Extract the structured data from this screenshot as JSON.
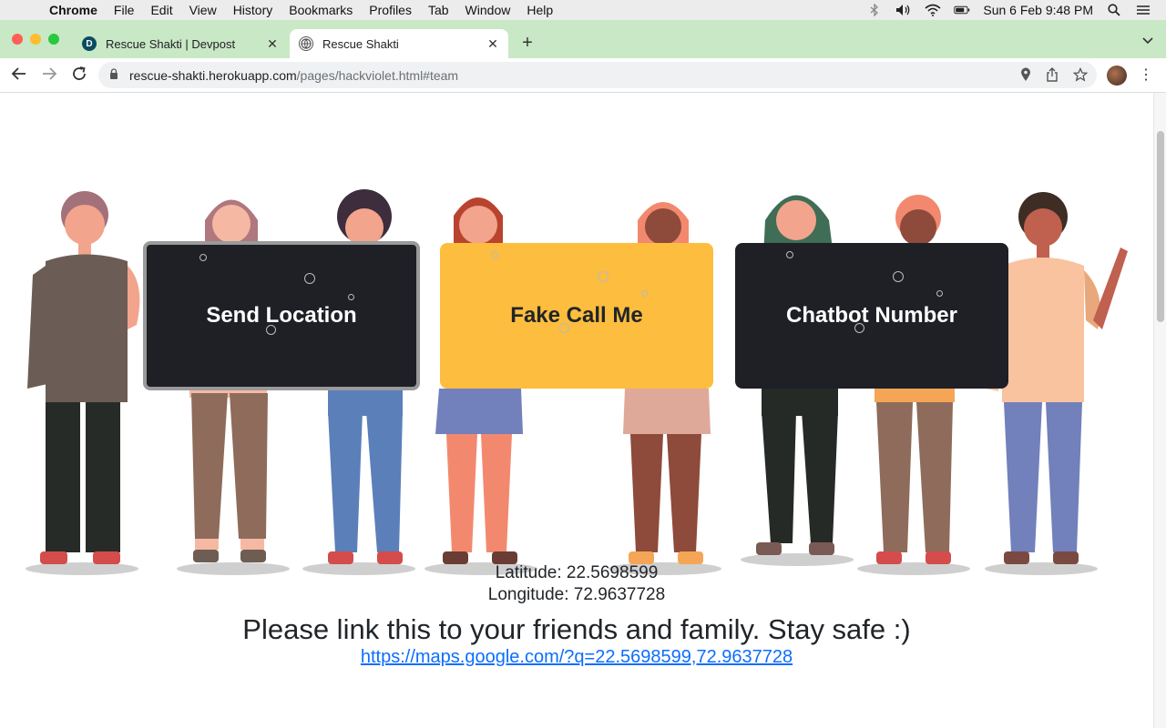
{
  "menubar": {
    "app_name": "Chrome",
    "items": [
      "File",
      "Edit",
      "View",
      "History",
      "Bookmarks",
      "Profiles",
      "Tab",
      "Window",
      "Help"
    ],
    "clock": "Sun 6 Feb  9:48 PM"
  },
  "tabs": [
    {
      "title": "Rescue Shakti | Devpost",
      "favicon": "D"
    },
    {
      "title": "Rescue Shakti",
      "favicon": "🌐"
    }
  ],
  "address_bar": {
    "host": "rescue-shakti.herokuapp.com",
    "path": "/pages/hackviolet.html#team"
  },
  "buttons": {
    "send_location": "Send Location",
    "fake_call": "Fake Call Me",
    "chatbot": "Chatbot Number"
  },
  "location": {
    "latitude_line": "Latitude: 22.5698599",
    "longitude_line": "Longitude: 72.9637728"
  },
  "message": "Please link this to your friends and family. Stay safe :)",
  "map_link": "https://maps.google.com/?q=22.5698599,72.9637728",
  "colors": {
    "tab_strip": "#c9e8c5",
    "dark_button": "#1e2026",
    "yellow_button": "#fdbd3e",
    "link": "#0d6efd"
  }
}
